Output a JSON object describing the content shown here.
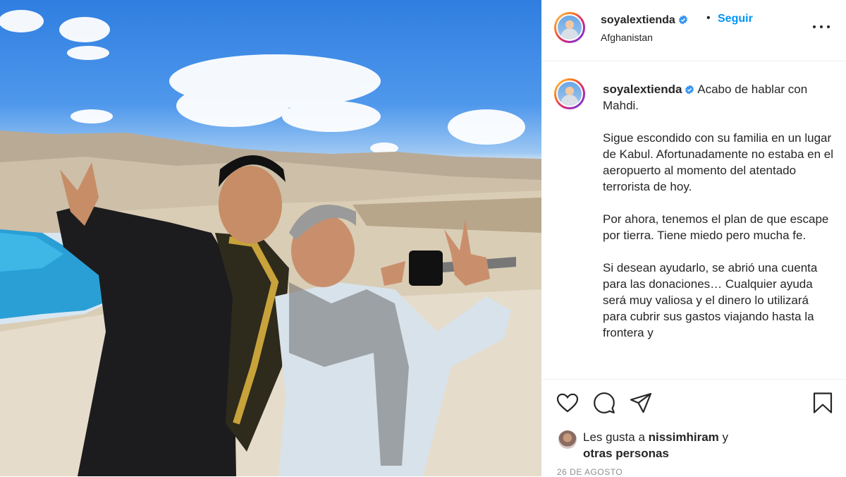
{
  "post": {
    "image_alt": "Two men smiling in front of a mountain landscape with a blue lake",
    "username": "soyalextienda",
    "follow_label": "Seguir",
    "bullet": "•",
    "location": "Afghanistan"
  },
  "caption": {
    "username": "soyalextienda",
    "lines": [
      "Acabo de hablar con Mahdi.",
      "Sigue escondido con su familia en un lugar de Kabul. Afortunadamente no estaba en el aeropuerto al momento del atentado terrorista de hoy.",
      "Por ahora, tenemos el plan de que escape por tierra. Tiene miedo pero mucha fe.",
      "Si desean ayudarlo, se abrió una cuenta para las donaciones… Cualquier ayuda será muy valiosa y el dinero lo utilizará para cubrir sus gastos viajando hasta la frontera y"
    ]
  },
  "likes": {
    "prefix": "Les gusta a ",
    "user": "nissimhiram",
    "connector": " y",
    "others": "otras personas"
  },
  "date": "26 DE AGOSTO",
  "colors": {
    "accent": "#0095f6",
    "text": "#262626",
    "muted": "#8e8e8e",
    "verified": "#3897f0"
  },
  "icons": [
    "verified-badge-icon",
    "more-options-icon",
    "heart-icon",
    "comment-icon",
    "share-icon",
    "bookmark-icon"
  ]
}
